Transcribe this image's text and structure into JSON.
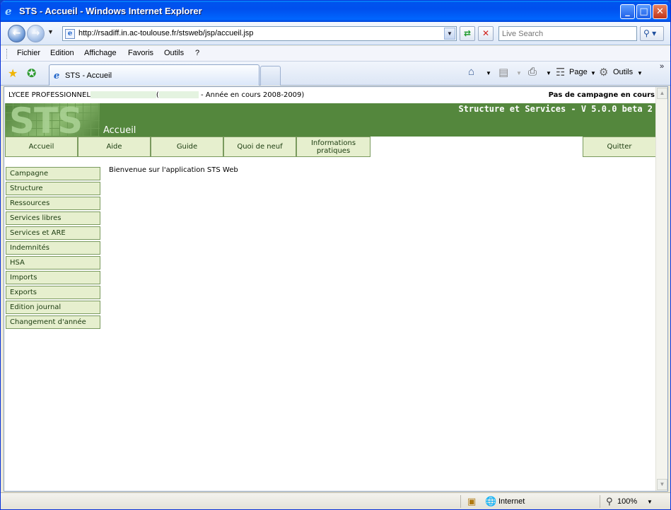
{
  "window": {
    "title": "STS - Accueil - Windows Internet Explorer",
    "minimize": "_",
    "maximize": "□",
    "close": "✕"
  },
  "address_bar": {
    "url": "http://rsadiff.in.ac-toulouse.fr/stsweb/jsp/accueil.jsp",
    "search_placeholder": "Live Search",
    "search_icon": "search-icon"
  },
  "menu": [
    "Fichier",
    "Edition",
    "Affichage",
    "Favoris",
    "Outils",
    "?"
  ],
  "tab": {
    "label": "STS - Accueil"
  },
  "command_bar": {
    "page_label": "Page",
    "tools_label": "Outils"
  },
  "page": {
    "lycee_prefix": "LYCEE PROFESSIONNEL",
    "lycee_year": "- Année en cours 2008-2009)",
    "campaign_status": "Pas de campagne en cours",
    "logo_text": "STS",
    "version": "Structure et Services - V 5.0.0 beta 2",
    "title": "Accueil",
    "top_nav": [
      "Accueil",
      "Aide",
      "Guide",
      "Quoi de neuf",
      "Informations pratiques"
    ],
    "quit_label": "Quitter",
    "side_menu": [
      "Campagne",
      "Structure",
      "Ressources",
      "Services libres",
      "Services et ARE",
      "Indemnités",
      "HSA",
      "Imports",
      "Exports",
      "Edition journal",
      "Changement d'année"
    ],
    "welcome": "Bienvenue sur l'application STS Web"
  },
  "status_bar": {
    "zone": "Internet",
    "zoom": "100%"
  },
  "colors": {
    "banner_green": "#54873d",
    "nav_bg": "#e6efce",
    "nav_border": "#7a9a5e"
  }
}
